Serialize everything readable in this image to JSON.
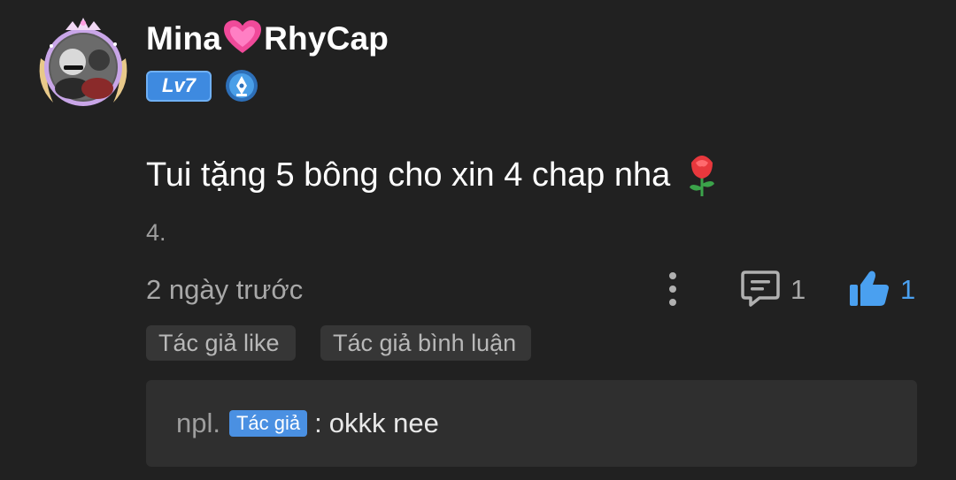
{
  "user": {
    "name_part1": "Mina",
    "name_emoji": "heart-icon",
    "name_part2": "RhyCap",
    "level": "Lv7"
  },
  "comment": {
    "text": "Tui tặng 5 bông cho xin 4 chap nha",
    "emoji": "rose-icon",
    "index": "4.",
    "time": "2 ngày trước",
    "reply_count": "1",
    "like_count": "1"
  },
  "tags": {
    "author_like": "Tác giả like",
    "author_comment": "Tác giả bình luận"
  },
  "reply": {
    "author": "npl.",
    "author_badge": "Tác giả",
    "separator": ":",
    "text": "okkk nee"
  },
  "colors": {
    "background": "#212121",
    "accent_blue": "#4aa0f0",
    "muted_text": "#a8a8a8"
  }
}
